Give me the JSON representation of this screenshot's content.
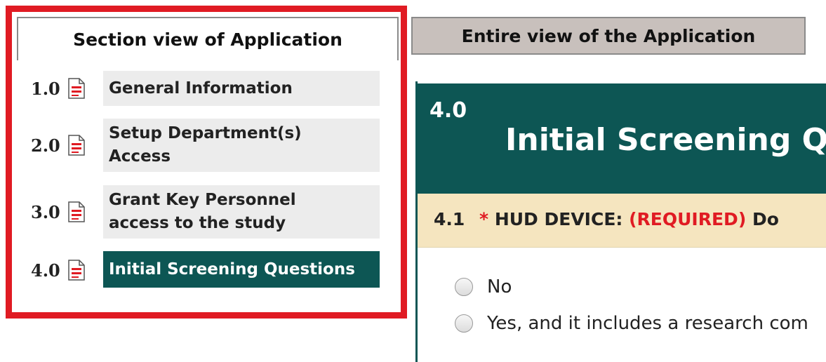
{
  "tabs": [
    {
      "label": "Section view of Application",
      "active": true
    },
    {
      "label": "Entire view of the Application",
      "active": false
    }
  ],
  "sections": [
    {
      "number": "1.0",
      "label": "General Information"
    },
    {
      "number": "2.0",
      "label": "Setup Department(s) Access"
    },
    {
      "number": "3.0",
      "label": "Grant Key Personnel access to the study"
    },
    {
      "number": "4.0",
      "label": "Initial Screening Questions",
      "selected": true
    }
  ],
  "content": {
    "section_number": "4.0",
    "section_title": "Initial Screening Q",
    "question": {
      "number": "4.1",
      "asterisk": "*",
      "label": "HUD DEVICE:",
      "required": "(REQUIRED)",
      "text_tail": "Do"
    },
    "options": [
      "No",
      "Yes, and it includes a research com"
    ]
  },
  "colors": {
    "accent": "#0d5654",
    "highlight": "#e01b23",
    "question_bg": "#f5e5bf",
    "tab_inactive_bg": "#c8c0bc"
  },
  "icons": {
    "document": "pdf-document-icon"
  }
}
